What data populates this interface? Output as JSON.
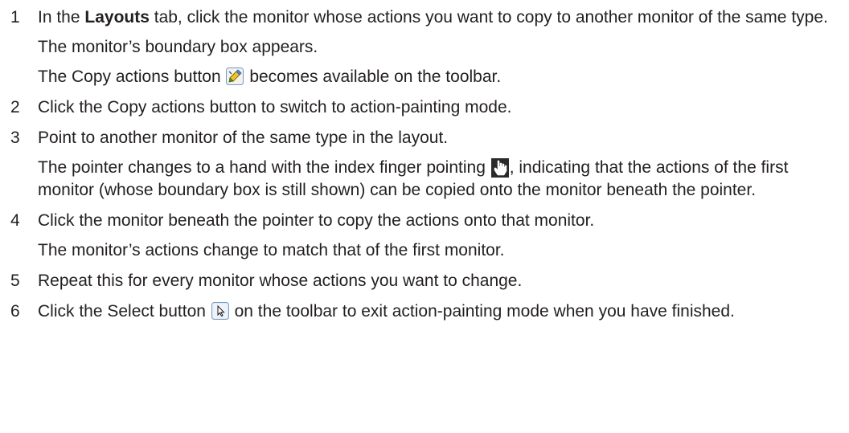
{
  "steps": [
    {
      "number": "1",
      "pre": "In the ",
      "bold": "Layouts",
      "post": " tab, click the monitor whose actions you want to copy to another monitor of the same type.",
      "notes": [
        "The monitor’s boundary box appears."
      ],
      "icon_note": {
        "pre": "The Copy actions button ",
        "icon": "copy-actions-icon",
        "post": " becomes available on the toolbar."
      }
    },
    {
      "number": "2",
      "text": "Click the Copy actions button to switch to action-painting mode."
    },
    {
      "number": "3",
      "text": "Point to another monitor of the same type in the layout.",
      "icon_note": {
        "pre": "The pointer changes to a hand with the index finger pointing ",
        "icon": "hand-pointer-icon",
        "post": ", indicating that the actions of the first monitor (whose boundary box is still shown) can be copied onto the monitor beneath the pointer."
      }
    },
    {
      "number": "4",
      "text": "Click the monitor beneath the pointer to copy the actions onto that monitor.",
      "note": "The monitor’s actions change to match that of the first monitor."
    },
    {
      "number": "5",
      "text": "Repeat this for every monitor whose actions you want to change."
    },
    {
      "number": "6",
      "pre": "Click the Select button ",
      "icon": "select-arrow-icon",
      "post": " on the toolbar to exit action-painting mode when you have finished."
    }
  ],
  "colors": {
    "text": "#231f20",
    "icon_border": "#7a9cc6"
  }
}
